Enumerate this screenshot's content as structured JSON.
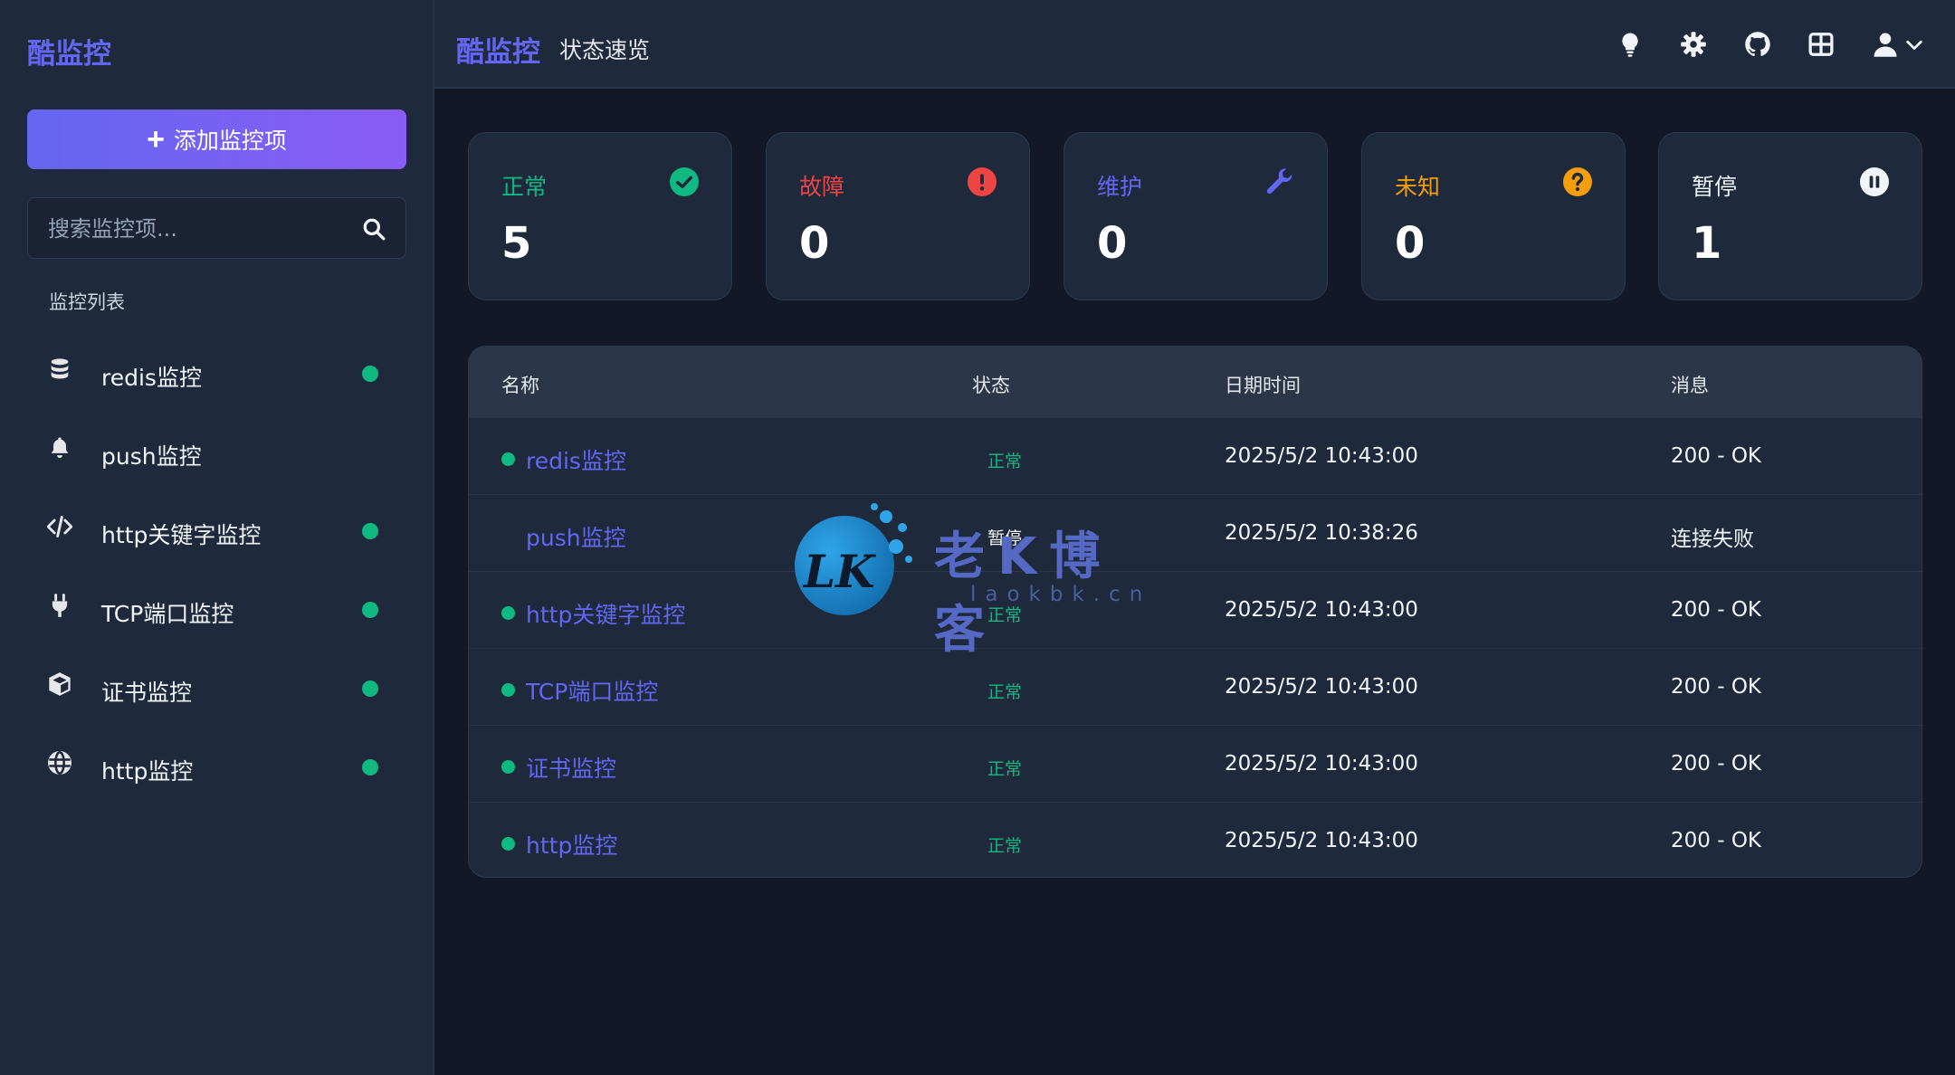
{
  "sidebar": {
    "brand": "酷监控",
    "add_button": "添加监控项",
    "search_placeholder": "搜索监控项...",
    "list_title": "监控列表",
    "items": [
      {
        "label": "redis监控",
        "icon": "database-icon",
        "status_dot": true
      },
      {
        "label": "push监控",
        "icon": "bell-icon",
        "status_dot": false
      },
      {
        "label": "http关键字监控",
        "icon": "code-icon",
        "status_dot": true
      },
      {
        "label": "TCP端口监控",
        "icon": "plug-icon",
        "status_dot": true
      },
      {
        "label": "证书监控",
        "icon": "cube-icon",
        "status_dot": true
      },
      {
        "label": "http监控",
        "icon": "globe-icon",
        "status_dot": true
      }
    ]
  },
  "topbar": {
    "brand": "酷监控",
    "subtitle": "状态速览",
    "icons": [
      "lightbulb-icon",
      "gear-icon",
      "github-icon",
      "grid-icon",
      "user-icon",
      "chevron-down-icon"
    ]
  },
  "cards": [
    {
      "label": "正常",
      "value": "5",
      "color": "#10b981",
      "icon": "check-circle-icon"
    },
    {
      "label": "故障",
      "value": "0",
      "color": "#ef4444",
      "icon": "exclamation-circle-icon"
    },
    {
      "label": "维护",
      "value": "0",
      "color": "#6366f1",
      "icon": "wrench-icon"
    },
    {
      "label": "未知",
      "value": "0",
      "color": "#f59e0b",
      "icon": "question-circle-icon"
    },
    {
      "label": "暂停",
      "value": "1",
      "color": "#f1f5f9",
      "icon": "pause-circle-icon"
    }
  ],
  "table": {
    "headers": [
      "名称",
      "状态",
      "日期时间",
      "消息"
    ],
    "rows": [
      {
        "name": "redis监控",
        "status": "正常",
        "time": "2025/5/2 10:43:00",
        "message": "200 - OK",
        "dot": true
      },
      {
        "name": "push监控",
        "status": "暂停",
        "time": "2025/5/2 10:38:26",
        "message": "连接失败",
        "dot": false
      },
      {
        "name": "http关键字监控",
        "status": "正常",
        "time": "2025/5/2 10:43:00",
        "message": "200 - OK",
        "dot": true
      },
      {
        "name": "TCP端口监控",
        "status": "正常",
        "time": "2025/5/2 10:43:00",
        "message": "200 - OK",
        "dot": true
      },
      {
        "name": "证书监控",
        "status": "正常",
        "time": "2025/5/2 10:43:00",
        "message": "200 - OK",
        "dot": true
      },
      {
        "name": "http监控",
        "status": "正常",
        "time": "2025/5/2 10:43:00",
        "message": "200 - OK",
        "dot": true
      }
    ]
  },
  "colors": {
    "accent": "#6366f1",
    "ok": "#10b981",
    "bg": "#121827",
    "panel": "#1e293b"
  },
  "watermark": {
    "logo": "LK",
    "title": "老K博客",
    "domain": "laokbk.cn"
  }
}
